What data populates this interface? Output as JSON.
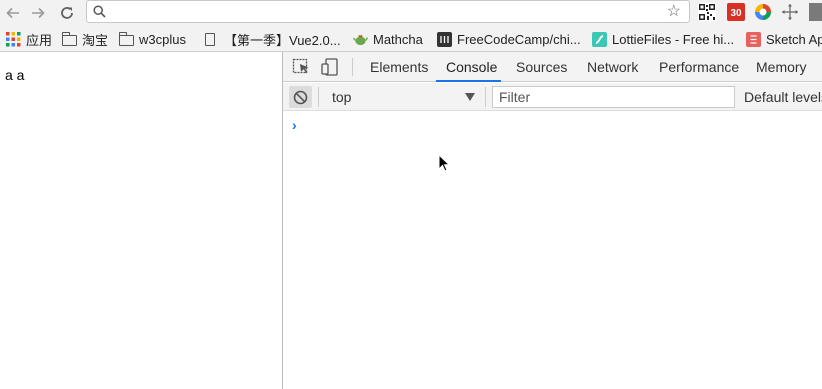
{
  "toolbar": {
    "address_value": "",
    "back_icon": "arrow-left-icon",
    "forward_icon": "arrow-right-icon",
    "reload_icon": "reload-icon",
    "search_icon": "search-icon",
    "star_icon": "star-icon",
    "extensions": [
      {
        "name": "qr-code-icon"
      },
      {
        "name": "calendar-30-icon",
        "text": "30"
      },
      {
        "name": "color-wheel-icon"
      },
      {
        "name": "move-cross-icon"
      },
      {
        "name": "gray-square-icon"
      }
    ]
  },
  "bookmarks": {
    "items": [
      {
        "label": "应用",
        "icon": "apps-grid-icon"
      },
      {
        "label": "淘宝",
        "icon": "folder-icon"
      },
      {
        "label": "w3cplus",
        "icon": "folder-icon"
      },
      {
        "label": "【第一季】Vue2.0...",
        "icon": "document-icon"
      },
      {
        "label": "Mathcha",
        "icon": "teapot-icon"
      },
      {
        "label": "FreeCodeCamp/chi...",
        "icon": "github-dark-icon"
      },
      {
        "label": "LottieFiles - Free hi...",
        "icon": "lottie-icon"
      },
      {
        "label": "Sketch Ap",
        "icon": "sketch-icon"
      }
    ]
  },
  "page": {
    "text": "a a"
  },
  "devtools": {
    "tabs": [
      "Elements",
      "Console",
      "Sources",
      "Network",
      "Performance",
      "Memory"
    ],
    "active_tab": "Console",
    "context": "top",
    "filter_placeholder": "Filter",
    "levels_label": "Default levels",
    "prompt_symbol": "›",
    "colors": {
      "accent": "#1a73e8"
    }
  }
}
